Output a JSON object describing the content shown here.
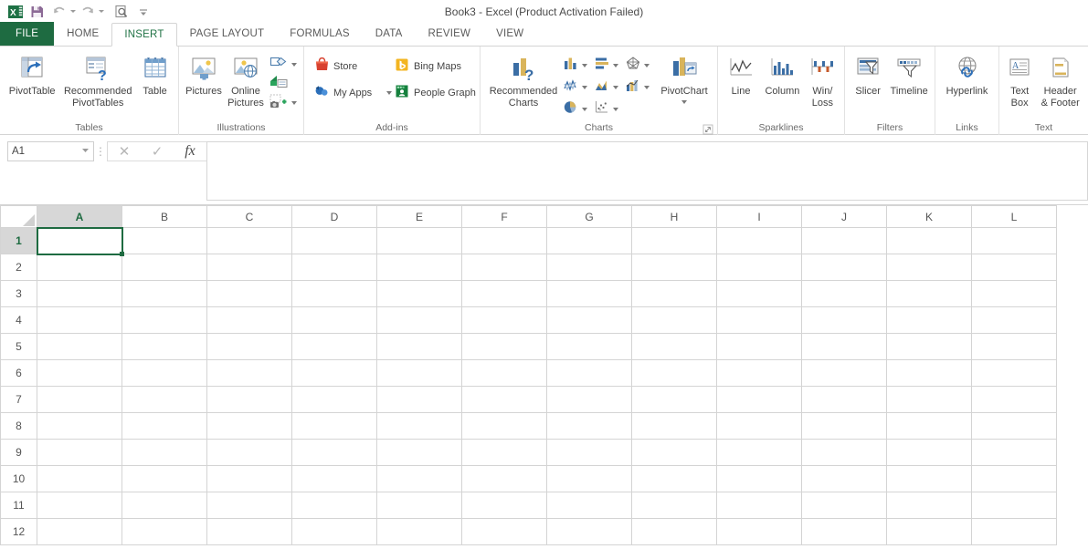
{
  "window": {
    "title": "Book3 - Excel (Product Activation Failed)"
  },
  "quick_access": {
    "items": [
      {
        "name": "excel-logo-icon",
        "label": "Excel"
      },
      {
        "name": "save-icon",
        "label": "Save"
      },
      {
        "name": "undo-icon",
        "label": "Undo"
      },
      {
        "name": "redo-icon",
        "label": "Redo"
      },
      {
        "name": "print-preview-icon",
        "label": "Print Preview and Print"
      },
      {
        "name": "customize-quick-access-toolbar-icon",
        "label": "Customize Quick Access Toolbar"
      }
    ]
  },
  "ribbon": {
    "tabs": [
      {
        "label": "FILE",
        "active": false
      },
      {
        "label": "HOME",
        "active": false
      },
      {
        "label": "INSERT",
        "active": true
      },
      {
        "label": "PAGE LAYOUT",
        "active": false
      },
      {
        "label": "FORMULAS",
        "active": false
      },
      {
        "label": "DATA",
        "active": false
      },
      {
        "label": "REVIEW",
        "active": false
      },
      {
        "label": "VIEW",
        "active": false
      }
    ],
    "groups": {
      "tables": {
        "label": "Tables",
        "pivot_table": "PivotTable",
        "recommended_pivot_tables": "Recommended\nPivotTables",
        "recommended_pivot_tables_l1": "Recommended",
        "recommended_pivot_tables_l2": "PivotTables",
        "table": "Table"
      },
      "illustrations": {
        "label": "Illustrations",
        "pictures": "Pictures",
        "online_pictures_l1": "Online",
        "online_pictures_l2": "Pictures",
        "shapes": "Shapes",
        "smartart": "SmartArt",
        "screenshot": "Screenshot"
      },
      "addins": {
        "label": "Add-ins",
        "store": "Store",
        "bing_maps": "Bing Maps",
        "my_apps": "My Apps",
        "people_graph": "People Graph"
      },
      "charts": {
        "label": "Charts",
        "recommended_charts_l1": "Recommended",
        "recommended_charts_l2": "Charts",
        "pivot_chart": "PivotChart",
        "types": [
          {
            "name": "insert-column-chart",
            "label": "Insert Column or Bar Chart"
          },
          {
            "name": "insert-hierarchy-chart",
            "label": "Insert Hierarchy Chart"
          },
          {
            "name": "insert-waterfall-chart",
            "label": "Insert Waterfall or Stock Chart"
          },
          {
            "name": "insert-line-chart",
            "label": "Insert Line or Area Chart"
          },
          {
            "name": "insert-area-chart",
            "label": "Insert Statistic Chart"
          },
          {
            "name": "insert-combo-chart",
            "label": "Insert Combo Chart"
          },
          {
            "name": "insert-pie-chart",
            "label": "Insert Pie or Doughnut Chart"
          },
          {
            "name": "insert-scatter-chart",
            "label": "Insert Scatter or Bubble Chart"
          }
        ],
        "dialog_launcher": "Charts dialog box launcher"
      },
      "sparklines": {
        "label": "Sparklines",
        "line": "Line",
        "column": "Column",
        "winloss_l1": "Win/",
        "winloss_l2": "Loss"
      },
      "filters": {
        "label": "Filters",
        "slicer": "Slicer",
        "timeline": "Timeline"
      },
      "links": {
        "label": "Links",
        "hyperlink": "Hyperlink"
      },
      "text": {
        "label": "Text",
        "text_box_l1": "Text",
        "text_box_l2": "Box",
        "header_footer_l1": "Header",
        "header_footer_l2": "& Footer"
      }
    }
  },
  "formula_bar": {
    "name_box_value": "A1",
    "cancel": "✕",
    "enter": "✓",
    "insert_function": "fx",
    "value": "",
    "placeholder": ""
  },
  "sheet": {
    "columns": [
      "A",
      "B",
      "C",
      "D",
      "E",
      "F",
      "G",
      "H",
      "I",
      "J",
      "K",
      "L"
    ],
    "rows": [
      1,
      2,
      3,
      4,
      5,
      6,
      7,
      8,
      9,
      10,
      11,
      12
    ],
    "selected_cell": "A1",
    "selected_column": "A",
    "selected_row": 1,
    "cells": {}
  },
  "colors": {
    "excel_green": "#1e6b41",
    "tab_active_text": "#217346",
    "header_selected_bg": "#d7d7d7",
    "grid_line": "#d4d4d4",
    "store_red": "#d8412f",
    "bing_yellow": "#f3b521",
    "myapps_blue": "#2b6fba",
    "people_green": "#15803d",
    "chart_blue": "#3b6ea5",
    "chart_gold": "#d9b45b"
  }
}
